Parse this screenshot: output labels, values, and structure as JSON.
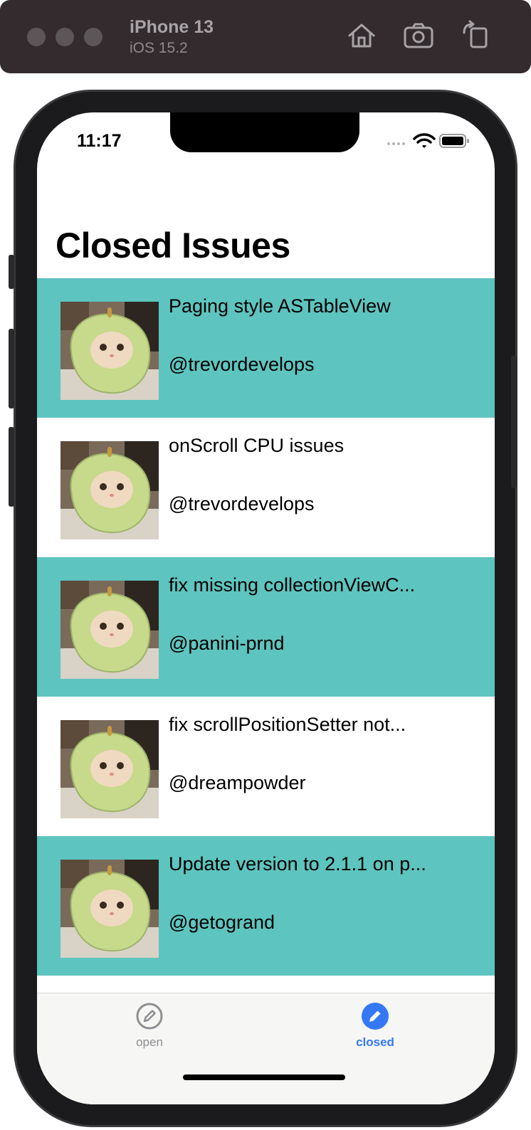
{
  "simulator": {
    "device_name": "iPhone 13",
    "os_version": "iOS 15.2",
    "toolbar_icons": [
      "home-icon",
      "screenshot-icon",
      "rotate-icon"
    ]
  },
  "status_bar": {
    "time": "11:17"
  },
  "page": {
    "title": "Closed Issues"
  },
  "issues": [
    {
      "title": "Paging style ASTableView",
      "author": "@trevordevelops",
      "highlight": true
    },
    {
      "title": "onScroll CPU issues",
      "author": "@trevordevelops",
      "highlight": false
    },
    {
      "title": "fix missing collectionViewC...",
      "author": "@panini-prnd",
      "highlight": true
    },
    {
      "title": "fix scrollPositionSetter not...",
      "author": "@dreampowder",
      "highlight": false
    },
    {
      "title": "Update version to 2.1.1 on p...",
      "author": "@getogrand",
      "highlight": true
    }
  ],
  "tabbar": {
    "tabs": [
      {
        "label": "open",
        "icon": "pencil-circle-icon",
        "selected": false
      },
      {
        "label": "closed",
        "icon": "pencil-circle-filled-icon",
        "selected": true
      }
    ]
  },
  "colors": {
    "row_highlight": "#5ec4bf",
    "tab_active": "#3478f6",
    "tab_inactive": "#8e8e93"
  }
}
